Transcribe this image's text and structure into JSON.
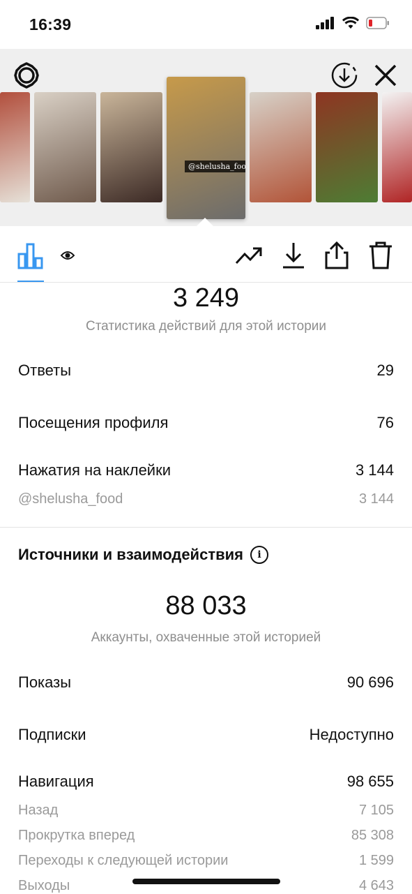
{
  "status_bar": {
    "time": "16:39"
  },
  "story_header": {
    "thumbnails": [
      {
        "id": "t1",
        "label": "",
        "colors": [
          "#b24f3d",
          "#e6e1d8"
        ]
      },
      {
        "id": "t2",
        "label": "",
        "colors": [
          "#d9d0c5",
          "#6f5a4c"
        ]
      },
      {
        "id": "t3",
        "label": "",
        "colors": [
          "#c9b59a",
          "#3c2a25"
        ]
      },
      {
        "id": "t4",
        "label": "@shelusha_food",
        "colors": [
          "#c79a4a",
          "#6c6c6c"
        ]
      },
      {
        "id": "t5",
        "label": "",
        "colors": [
          "#d7d1c8",
          "#b25438"
        ]
      },
      {
        "id": "t6",
        "label": "",
        "colors": [
          "#8e3522",
          "#4d7d34"
        ]
      },
      {
        "id": "t7",
        "label": "",
        "colors": [
          "#f3f3f3",
          "#b02525"
        ]
      }
    ]
  },
  "stats": {
    "actions_total": "3 249",
    "actions_caption": "Статистика действий для этой истории",
    "rows": [
      {
        "label": "Ответы",
        "value": "29"
      },
      {
        "label": "Посещения профиля",
        "value": "76"
      },
      {
        "label": "Нажатия на наклейки",
        "value": "3 144"
      }
    ],
    "sticker_detail": {
      "label": "@shelusha_food",
      "value": "3 144"
    }
  },
  "discovery": {
    "title": "Источники и взаимодействия",
    "reach_total": "88 033",
    "reach_caption": "Аккаунты, охваченные этой историей",
    "rows": [
      {
        "label": "Показы",
        "value": "90 696"
      },
      {
        "label": "Подписки",
        "value": "Недоступно"
      },
      {
        "label": "Навигация",
        "value": "98 655"
      }
    ],
    "navigation_details": [
      {
        "label": "Назад",
        "value": "7 105"
      },
      {
        "label": "Прокрутка вперед",
        "value": "85 308"
      },
      {
        "label": "Переходы к следующей истории",
        "value": "1 599"
      },
      {
        "label": "Выходы",
        "value": "4 643"
      }
    ]
  },
  "colors": {
    "accent": "#3897f0",
    "muted": "#8e8e8e",
    "background": "#ffffff",
    "header_bg": "#efefef"
  }
}
